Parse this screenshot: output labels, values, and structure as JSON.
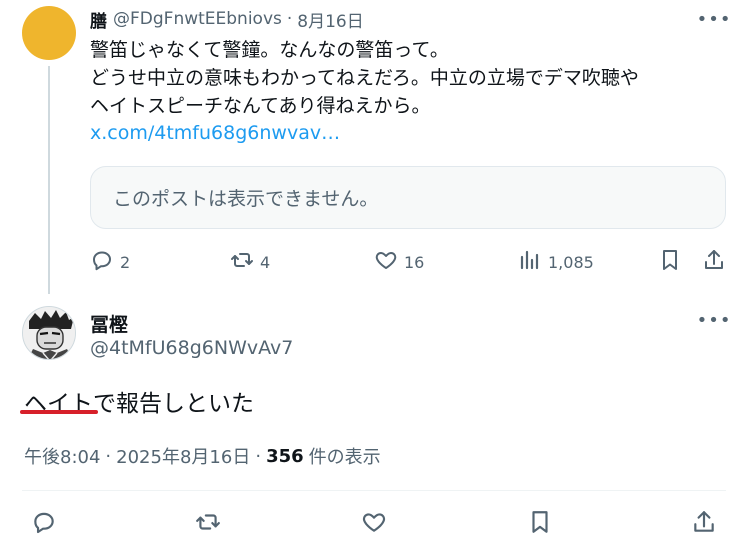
{
  "parent": {
    "name": "膳",
    "handle": "@FDgFnwtEEbniovs",
    "separator": "·",
    "date": "8月16日",
    "more": "•••",
    "body": "警笛じゃなくて警鐘。なんなの警笛って。\nどうせ中立の意味もわかってねえだろ。中立の立場でデマ吹聴や\nヘイトスピーチなんてあり得ねえから。",
    "link": "x.com/4tmfu68g6nwvav…",
    "quote_text": "このポストは表示できません。",
    "actions": {
      "replies": "2",
      "reposts": "4",
      "likes": "16",
      "views": "1,085"
    }
  },
  "reply": {
    "name": "冨樫",
    "handle": "@4tMfU68g6NWvAv7",
    "more": "•••",
    "body": "ヘイトで報告しといた",
    "time": "午後8:04",
    "separator": "·",
    "date": "2025年8月16日",
    "views_count": "356",
    "views_label": "件の表示"
  },
  "colors": {
    "accent": "#1d9bf0",
    "muted": "#536471",
    "parent_avatar": "#efb52d",
    "annotation_underline": "#d7202a"
  }
}
